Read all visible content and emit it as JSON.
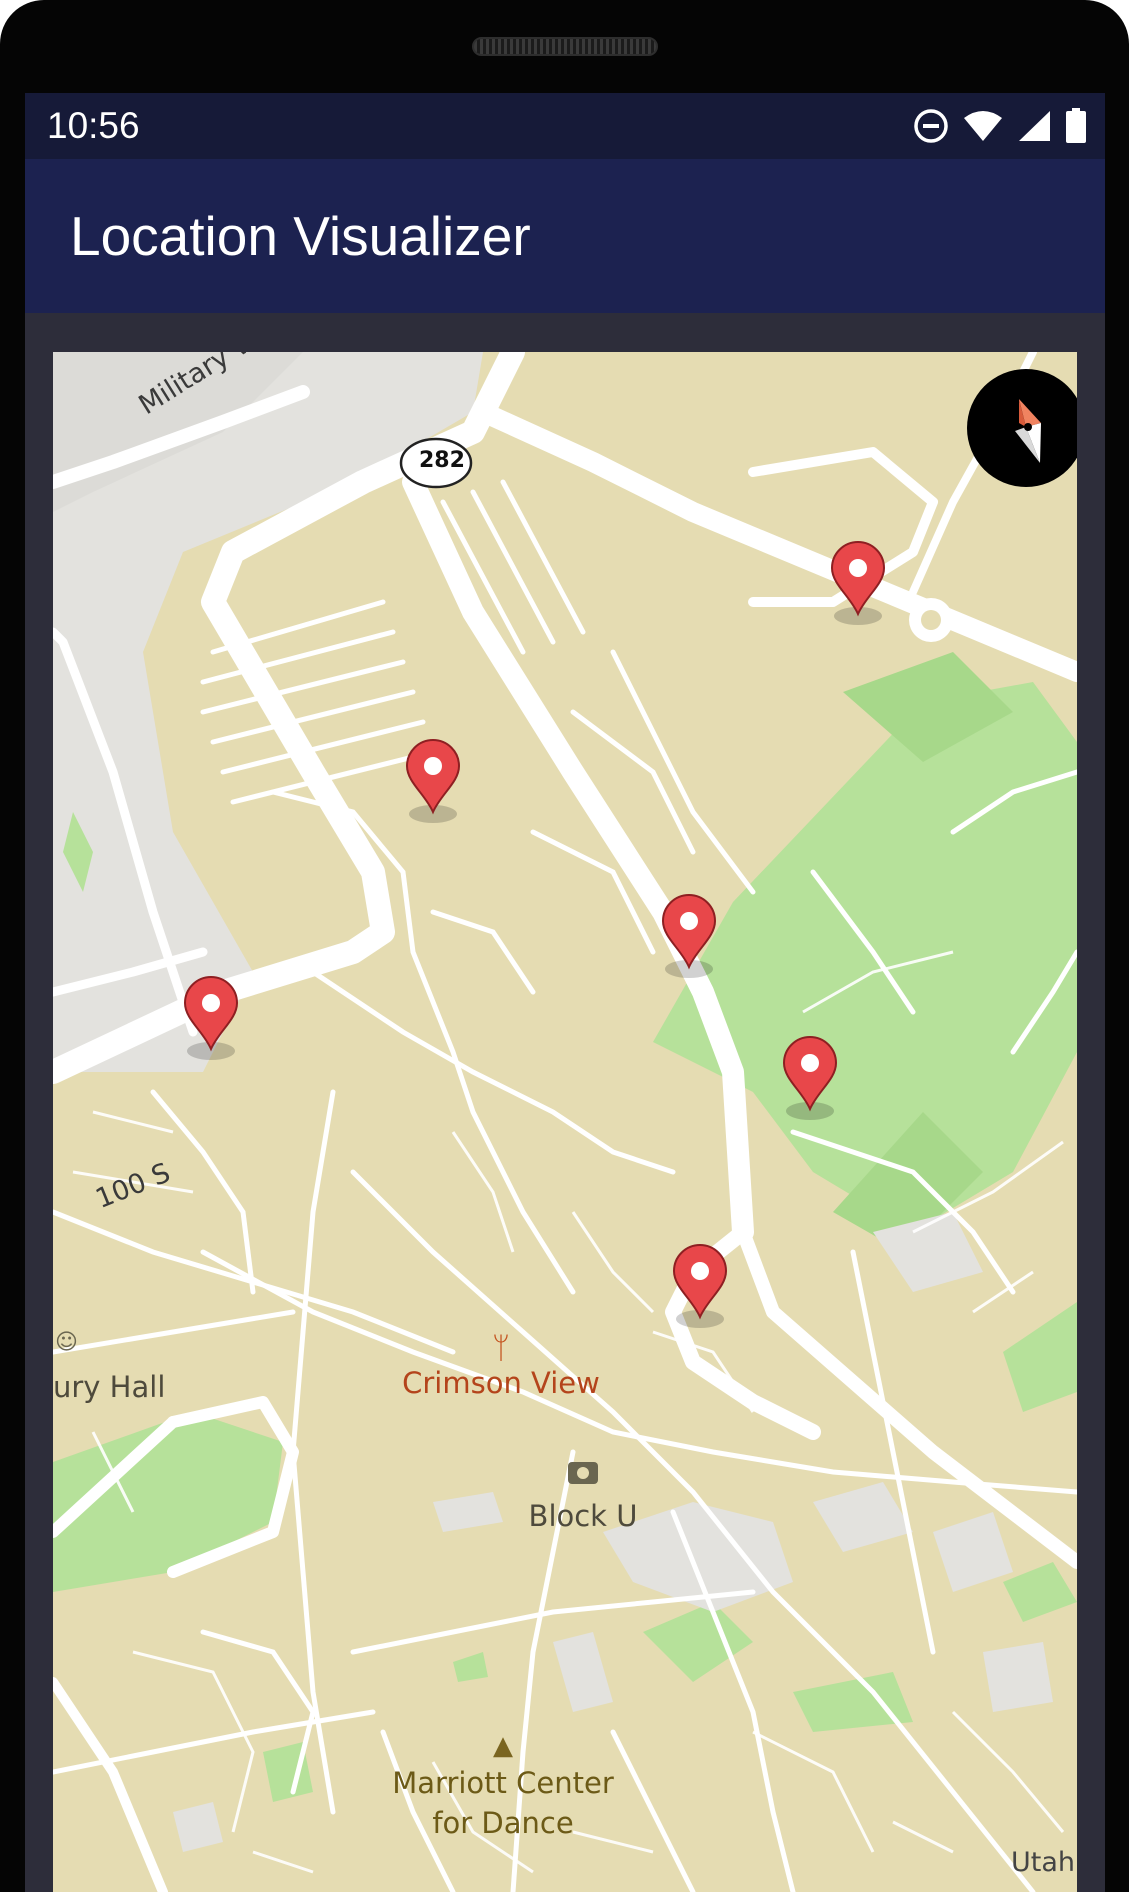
{
  "status_bar": {
    "time": "10:56",
    "icons": [
      "do-not-disturb-icon",
      "wifi-icon",
      "signal-icon",
      "battery-icon"
    ]
  },
  "app_bar": {
    "title": "Location Visualizer"
  },
  "map": {
    "road_labels": {
      "military_way": "Military Way",
      "hundred_s": "100 S",
      "highway": "282",
      "utah": "Utah"
    },
    "pois": {
      "crimson_view": "Crimson View",
      "block_u": "Block U",
      "marriott_line1": "Marriott Center",
      "marriott_line2": "for Dance",
      "hall_fragment": "ury Hall"
    },
    "markers": [
      {
        "name": "location-marker-1"
      },
      {
        "name": "location-marker-2"
      },
      {
        "name": "location-marker-3"
      },
      {
        "name": "location-marker-4"
      },
      {
        "name": "location-marker-5"
      },
      {
        "name": "location-marker-6"
      }
    ],
    "colors": {
      "land": "#e5dcb2",
      "park": "#b6e19a",
      "road": "#ffffff",
      "built": "#e3e2de",
      "marker": "#e8474a"
    }
  }
}
